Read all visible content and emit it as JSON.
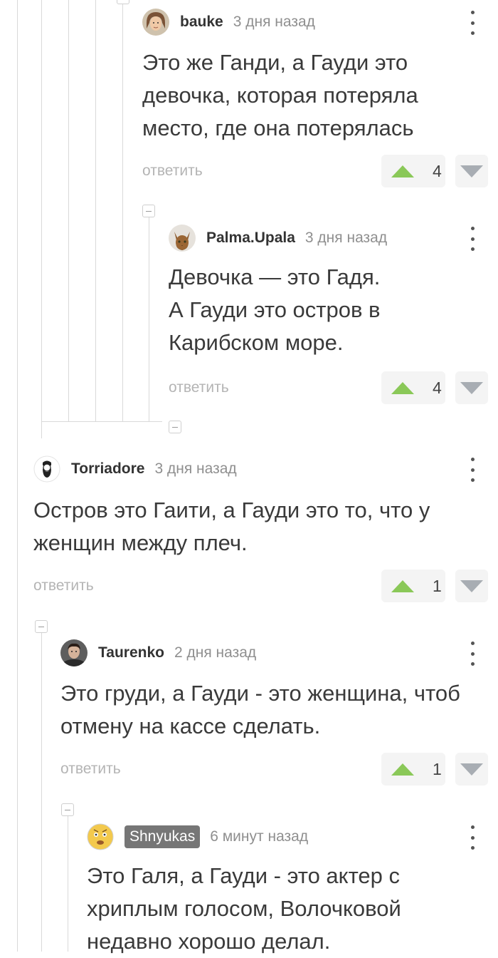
{
  "comments": [
    {
      "author": "bauke",
      "time": "3 дня назад",
      "text": "Это же Ганди, а Гауди это\nдевочка, которая потеряла\nместо, где она потерялась",
      "reply": "ответить",
      "votes": "4",
      "avatar_icon": "avatar-photo"
    },
    {
      "author": "Palma.Upala",
      "time": "3 дня назад",
      "text": "Девочка — это Гадя.\nА Гауди это остров в\nКарибском море.",
      "reply": "ответить",
      "votes": "4",
      "avatar_icon": "cat-avatar"
    },
    {
      "author": "Torriadore",
      "time": "3 дня назад",
      "text": "Остров это Гаити, а Гауди это то, что у\nженщин между плеч.",
      "reply": "ответить",
      "votes": "1",
      "avatar_icon": "bearded-man-avatar"
    },
    {
      "author": "Taurenko",
      "time": "2 дня назад",
      "text": "Это груди, а Гауди - это женщина, чтоб\nотмену на кассе сделать.",
      "reply": "ответить",
      "votes": "1",
      "avatar_icon": "avatar-photo"
    },
    {
      "author": "Shnyukas",
      "time": "6 минут назад",
      "text": "Это Галя, а Гауди - это актер с\nхриплым голосом, Волочковой\nнедавно хорошо делал.",
      "avatar_icon": "emoji-face-avatar"
    }
  ],
  "colors": {
    "upvote": "#8ac858",
    "downvote": "#a8adb3",
    "thread_line": "#d9d9d9",
    "badge": "#767676"
  }
}
